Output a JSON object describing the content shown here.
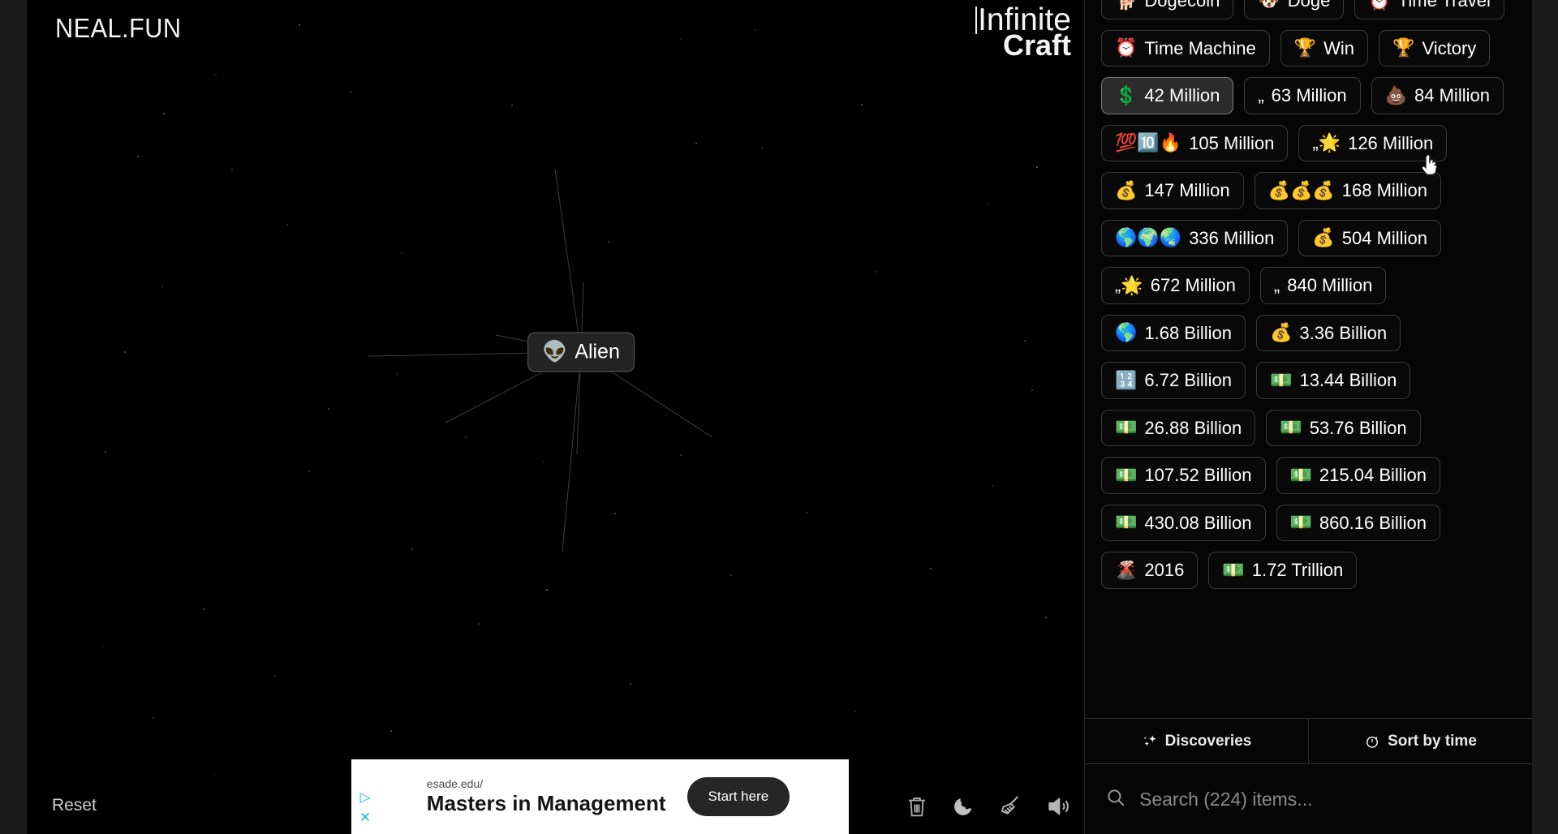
{
  "brand": {
    "logo": "NEAL.FUN"
  },
  "title": {
    "line1": "Infinite",
    "line2": "Craft"
  },
  "canvas": {
    "node": {
      "emoji": "👽",
      "label": "Alien",
      "icon_name": "alien-emoji"
    },
    "reset_label": "Reset"
  },
  "toolbar": {
    "items": [
      {
        "name": "trash-icon",
        "label": "Delete"
      },
      {
        "name": "moon-icon",
        "label": "Dark mode"
      },
      {
        "name": "broom-icon",
        "label": "Clear board"
      },
      {
        "name": "speaker-icon",
        "label": "Sound"
      }
    ]
  },
  "ad": {
    "url": "esade.edu/",
    "headline": "Masters in Management",
    "cta": "Start here",
    "adchoices_icon": "adchoices-triangle-icon",
    "close_icon": "close-x-icon"
  },
  "sidebar": {
    "items": [
      {
        "emoji": "🐕",
        "label": "Dogecoin",
        "hovered": false
      },
      {
        "emoji": "🐶",
        "label": "Doge",
        "hovered": false
      },
      {
        "emoji": "⏰",
        "label": "Time Travel",
        "hovered": false
      },
      {
        "emoji": "⏰",
        "label": "Time Machine",
        "hovered": false
      },
      {
        "emoji": "🏆",
        "label": "Win",
        "hovered": false
      },
      {
        "emoji": "🏆",
        "label": "Victory",
        "hovered": false
      },
      {
        "emoji": "💲",
        "label": "42 Million",
        "hovered": true
      },
      {
        "emoji": "„",
        "label": "63 Million",
        "hovered": false
      },
      {
        "emoji": "💩",
        "label": "84 Million",
        "hovered": false
      },
      {
        "emoji": "💯🔟🔥",
        "label": "105 Million",
        "hovered": false
      },
      {
        "emoji": "„🌟",
        "label": "126 Million",
        "hovered": false
      },
      {
        "emoji": "💰",
        "label": "147 Million",
        "hovered": false
      },
      {
        "emoji": "💰💰💰",
        "label": "168 Million",
        "hovered": false
      },
      {
        "emoji": "🌎🌍🌏",
        "label": "336 Million",
        "hovered": false
      },
      {
        "emoji": "💰",
        "label": "504 Million",
        "hovered": false
      },
      {
        "emoji": "„🌟",
        "label": "672 Million",
        "hovered": false
      },
      {
        "emoji": "„",
        "label": "840 Million",
        "hovered": false
      },
      {
        "emoji": "🌎",
        "label": "1.68 Billion",
        "hovered": false
      },
      {
        "emoji": "💰",
        "label": "3.36 Billion",
        "hovered": false
      },
      {
        "emoji": "🔢",
        "label": "6.72 Billion",
        "hovered": false
      },
      {
        "emoji": "💵",
        "label": "13.44 Billion",
        "hovered": false
      },
      {
        "emoji": "💵",
        "label": "26.88 Billion",
        "hovered": false
      },
      {
        "emoji": "💵",
        "label": "53.76 Billion",
        "hovered": false
      },
      {
        "emoji": "💵",
        "label": "107.52 Billion",
        "hovered": false
      },
      {
        "emoji": "💵",
        "label": "215.04 Billion",
        "hovered": false
      },
      {
        "emoji": "💵",
        "label": "430.08 Billion",
        "hovered": false
      },
      {
        "emoji": "💵",
        "label": "860.16 Billion",
        "hovered": false
      },
      {
        "emoji": "🌋",
        "label": "2016",
        "hovered": false
      },
      {
        "emoji": "💵",
        "label": "1.72 Trillion",
        "hovered": false
      }
    ],
    "tabs": [
      {
        "label": "Discoveries",
        "icon_name": "sparkles-icon",
        "active": true
      },
      {
        "label": "Sort by time",
        "icon_name": "stopwatch-icon",
        "active": false
      }
    ],
    "search": {
      "placeholder": "Search (224) items...",
      "value": "",
      "icon_name": "search-icon",
      "item_count": 224
    }
  },
  "colors": {
    "background": "#000000",
    "sidebar_bg": "#050505",
    "item_border": "#3a3a3a",
    "item_hover_bg": "#2b2b2b",
    "text": "#ffffff",
    "muted_text": "#8b8b8b",
    "ad_bg": "#ffffff",
    "ad_cta_bg": "#262626",
    "adchoices_blue": "#19b5e0"
  }
}
